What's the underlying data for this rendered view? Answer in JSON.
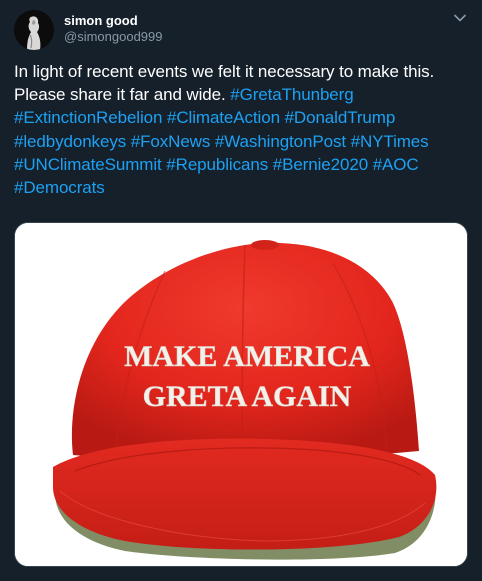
{
  "author": {
    "display_name": "simon good",
    "handle": "@simongood999"
  },
  "tweet": {
    "text": "In light of recent events we felt it necessary to make this. Please share it far and wide.",
    "hashtags": [
      "#GretaThunberg",
      "#ExtinctionRebelion",
      "#ClimateAction",
      "#DonaldTrump",
      "#ledbydonkeys",
      "#FoxNews",
      "#WashingtonPost",
      "#NYTimes",
      "#UNClimateSummit",
      "#Republicans",
      "#Bernie2020",
      "#AOC",
      "#Democrats"
    ]
  },
  "media": {
    "hat_line1": "MAKE AMERICA",
    "hat_line2": "GRETA AGAIN"
  },
  "icons": {
    "menu": "chevron-down-icon",
    "avatar": "avatar-silhouette"
  },
  "colors": {
    "background": "#15202b",
    "hashtag": "#1da1f2",
    "secondary_text": "#8899a6",
    "hat_red": "#e3261d"
  }
}
